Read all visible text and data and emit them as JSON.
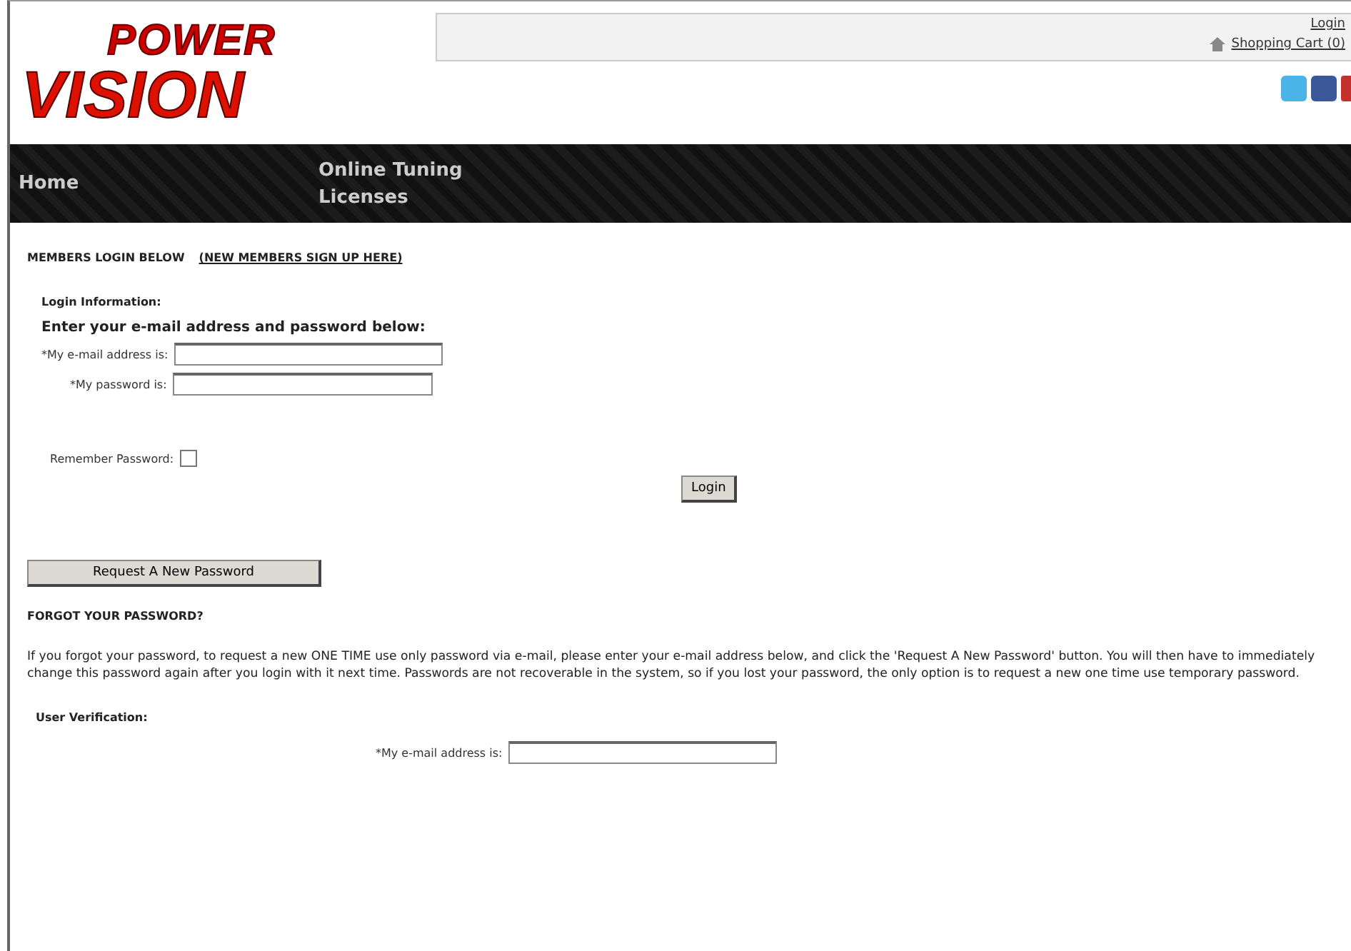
{
  "logo": {
    "top": "POWER",
    "bottom": "VISION"
  },
  "header": {
    "links": [
      "Login",
      "Shopping Cart (0)"
    ]
  },
  "nav": {
    "items": [
      {
        "label": "Home"
      },
      {
        "label": "Online Tuning Licenses"
      }
    ]
  },
  "login": {
    "heading": "MEMBERS LOGIN BELOW",
    "signup_link": "(NEW MEMBERS SIGN UP HERE)",
    "section_title": "Login Information:",
    "instructions": "Enter your e-mail address and password below:",
    "fields": [
      {
        "label": "*My e-mail address is:"
      },
      {
        "label": "*My password is:"
      }
    ],
    "remember": {
      "label": "Remember Password:",
      "checked": false
    },
    "button": "Login"
  },
  "forgot": {
    "button": "Request A New Password",
    "heading": "FORGOT YOUR PASSWORD?",
    "text": "If you forgot your password, to request a new ONE TIME use only password via e-mail, please enter your e-mail address below, and click the 'Request A New Password' button. You will then have to immediately change this password again after you login with it next time. Passwords are not recoverable in the system, so if you lost your password, the only option is to request a new one time use temporary password.",
    "section_title": "User Verification:",
    "field_label": "*My e-mail address is:"
  }
}
